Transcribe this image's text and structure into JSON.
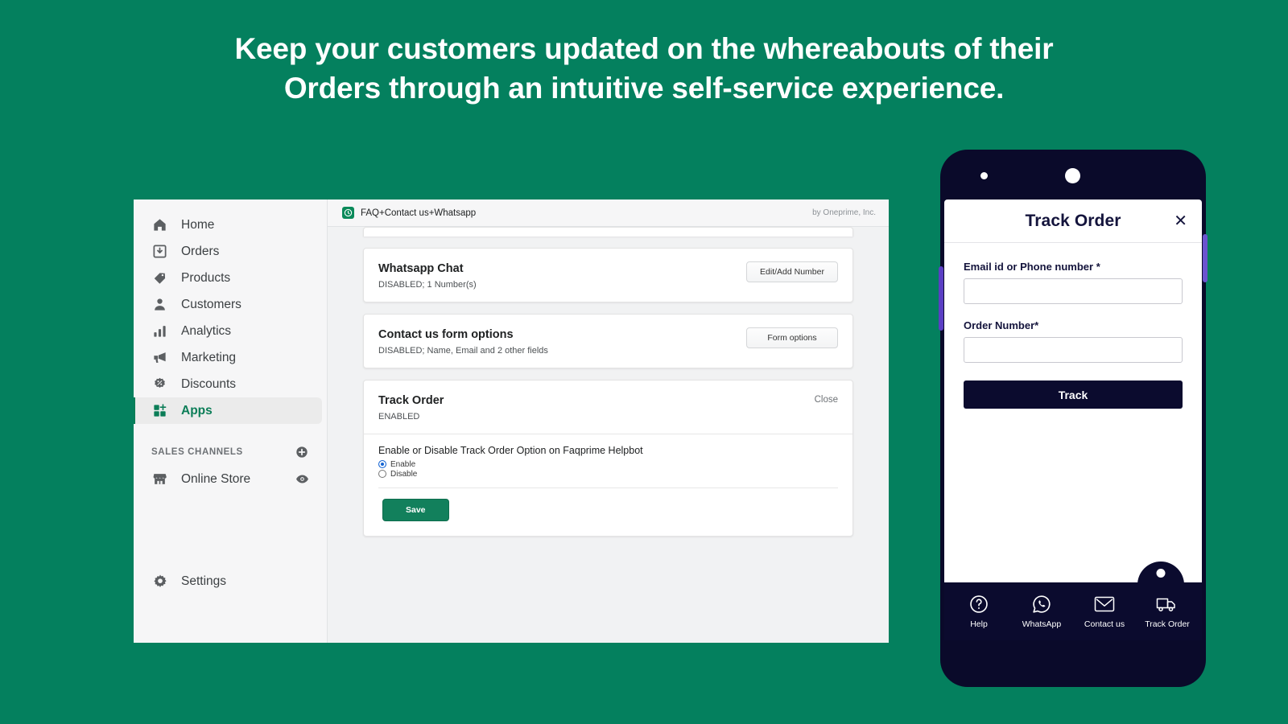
{
  "headline": {
    "line1": "Keep your customers updated on the whereabouts of their",
    "line2": "Orders through an intuitive self-service experience."
  },
  "colors": {
    "background_green": "#04805E",
    "accent_green": "#0b7d57",
    "save_green": "#12805c",
    "phone_navy": "#0a0a2a",
    "radio_blue": "#1464d2",
    "side_button_purple": "#5b3fc4"
  },
  "sidebar": {
    "items": [
      {
        "label": "Home",
        "icon": "home-icon",
        "active": false
      },
      {
        "label": "Orders",
        "icon": "orders-inbox-icon",
        "active": false
      },
      {
        "label": "Products",
        "icon": "tag-icon",
        "active": false
      },
      {
        "label": "Customers",
        "icon": "person-icon",
        "active": false
      },
      {
        "label": "Analytics",
        "icon": "bar-chart-icon",
        "active": false
      },
      {
        "label": "Marketing",
        "icon": "megaphone-icon",
        "active": false
      },
      {
        "label": "Discounts",
        "icon": "discount-badge-icon",
        "active": false
      },
      {
        "label": "Apps",
        "icon": "apps-grid-plus-icon",
        "active": true
      }
    ],
    "section_title": "SALES CHANNELS",
    "add_channel_icon": "plus-circle-icon",
    "channels": [
      {
        "label": "Online Store",
        "icon": "storefront-icon",
        "trailing_icon": "eye-icon"
      }
    ],
    "settings": {
      "label": "Settings",
      "icon": "gear-icon"
    }
  },
  "app_topbar": {
    "icon": "faqprime-app-icon",
    "name": "FAQ+Contact us+Whatsapp",
    "by": "by Oneprime, Inc."
  },
  "cards": [
    {
      "title": "Whatsapp Chat",
      "subtitle": "DISABLED; 1 Number(s)",
      "action_label": "Edit/Add Number"
    },
    {
      "title": "Contact us form options",
      "subtitle": "DISABLED; Name, Email and 2 other fields",
      "action_label": "Form options"
    }
  ],
  "track_order_card": {
    "title": "Track Order",
    "subtitle": "ENABLED",
    "close_label": "Close",
    "body_text": "Enable or Disable Track Order Option on Faqprime Helpbot",
    "options": [
      {
        "label": "Enable",
        "selected": true
      },
      {
        "label": "Disable",
        "selected": false
      }
    ],
    "save_label": "Save"
  },
  "phone": {
    "screen": {
      "title": "Track Order",
      "close_icon": "close-x-icon",
      "fields": [
        {
          "label": "Email id or Phone number *",
          "value": "",
          "placeholder": ""
        },
        {
          "label": "Order Number*",
          "value": "",
          "placeholder": ""
        }
      ],
      "submit_label": "Track"
    },
    "bottom_nav": [
      {
        "label": "Help",
        "icon": "question-circle-icon"
      },
      {
        "label": "WhatsApp",
        "icon": "whatsapp-icon"
      },
      {
        "label": "Contact us",
        "icon": "envelope-icon"
      },
      {
        "label": "Track Order",
        "icon": "delivery-truck-icon"
      }
    ]
  }
}
